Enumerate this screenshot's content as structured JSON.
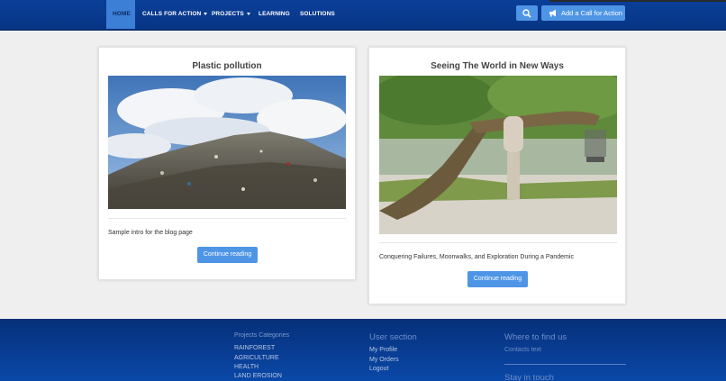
{
  "nav": {
    "items": [
      {
        "label": "HOME",
        "active": true
      },
      {
        "label": "CALLS FOR ACTION",
        "dropdown": true
      },
      {
        "label": "PROJECTS",
        "dropdown": true
      },
      {
        "label": "LEARNING"
      },
      {
        "label": "SOLUTIONS"
      }
    ],
    "search_icon": "search-icon",
    "cta_label": "Add a Call for Action",
    "cta_icon": "megaphone-icon"
  },
  "posts": [
    {
      "title": "Plastic pollution",
      "intro": "Sample intro for the blog page",
      "button": "Continue reading"
    },
    {
      "title": "Seeing The World in New Ways",
      "intro": "Conquering Failures, Moonwalks, and Exploration During a Pandemic",
      "button": "Continue reading"
    }
  ],
  "footer": {
    "projects_heading": "Projects Categories",
    "categories": [
      "RAINFOREST",
      "AGRICULTURE",
      "HEALTH",
      "LAND EROSION"
    ],
    "user_heading": "User section",
    "user_links": [
      "My Profile",
      "My Orders",
      "Logout"
    ],
    "find_heading": "Where to find us",
    "contacts": "Contacts text",
    "touch_heading": "Stay in touch"
  },
  "colors": {
    "nav_bg": "#0a3f98",
    "accent": "#4f95e6",
    "page_bg": "#efefef"
  }
}
